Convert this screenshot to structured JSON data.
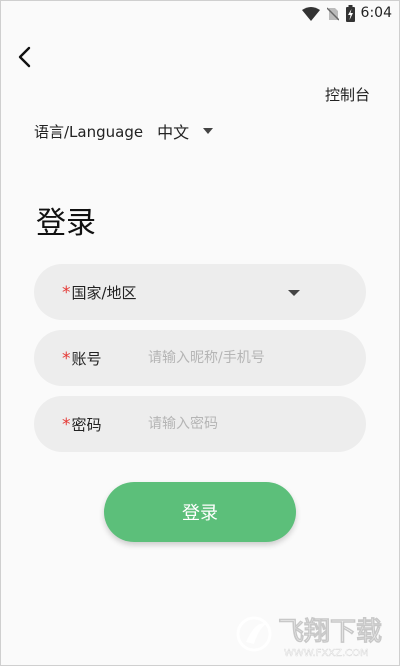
{
  "status_bar": {
    "time": "6:04",
    "icons": [
      "wifi-icon",
      "no-sim-icon",
      "battery-charging-icon"
    ]
  },
  "header": {
    "back_icon": "chevron-left-icon",
    "console_label": "控制台"
  },
  "language": {
    "label": "语言/Language",
    "selected": "中文"
  },
  "form": {
    "title": "登录",
    "region": {
      "label": "国家/地区"
    },
    "account": {
      "label": "账号",
      "placeholder": "请输入昵称/手机号"
    },
    "password": {
      "label": "密码",
      "placeholder": "请输入密码"
    },
    "required_mark": "*",
    "submit_label": "登录"
  },
  "watermark": {
    "text_cn": "飞翔下载",
    "text_en": "WWW.FXXZ.COM"
  },
  "colors": {
    "accent": "#5cbf7a",
    "required": "#e53935",
    "field_bg": "#ededed",
    "placeholder": "#b5b5b5"
  }
}
